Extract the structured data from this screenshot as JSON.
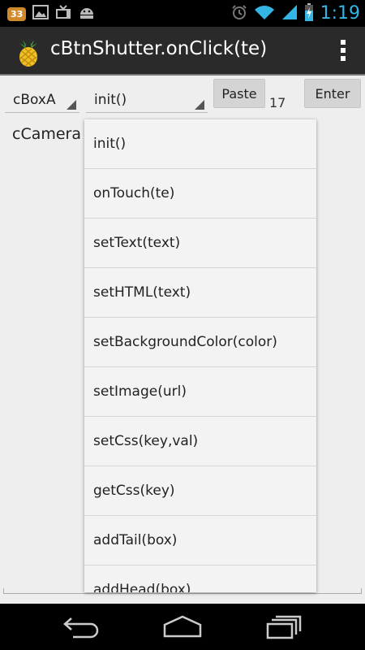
{
  "status_bar": {
    "notification_count": "33",
    "time": "1:19",
    "icons": [
      "image-icon",
      "tv-icon",
      "android-icon",
      "alarm-icon",
      "wifi-icon",
      "signal-icon",
      "battery-icon"
    ]
  },
  "action_bar": {
    "title": "cBtnShutter.onClick(te)",
    "app_icon": "pineapple-icon",
    "menu_icon": "overflow-menu-icon"
  },
  "toolbar": {
    "box_spinner_value": "cBoxA",
    "method_spinner_value": "init()",
    "paste_label": "Paste",
    "count": "17",
    "enter_label": "Enter"
  },
  "main": {
    "camera_label": "cCamera"
  },
  "dropdown": {
    "items": [
      "init()",
      "onTouch(te)",
      "setText(text)",
      "setHTML(text)",
      "setBackgroundColor(color)",
      "setImage(url)",
      "setCss(key,val)",
      "getCss(key)",
      "addTail(box)",
      "addHead(box)"
    ]
  },
  "nav_bar": {
    "icons": [
      "back-icon",
      "home-icon",
      "recents-icon"
    ]
  },
  "colors": {
    "status_bar_bg": "#000000",
    "clock": "#33b5e5",
    "action_bar_bg": "#2a2a2a",
    "content_bg": "#eeeeee",
    "dropdown_bg": "#f3f3f3",
    "button_bg": "#d4d4d4"
  }
}
